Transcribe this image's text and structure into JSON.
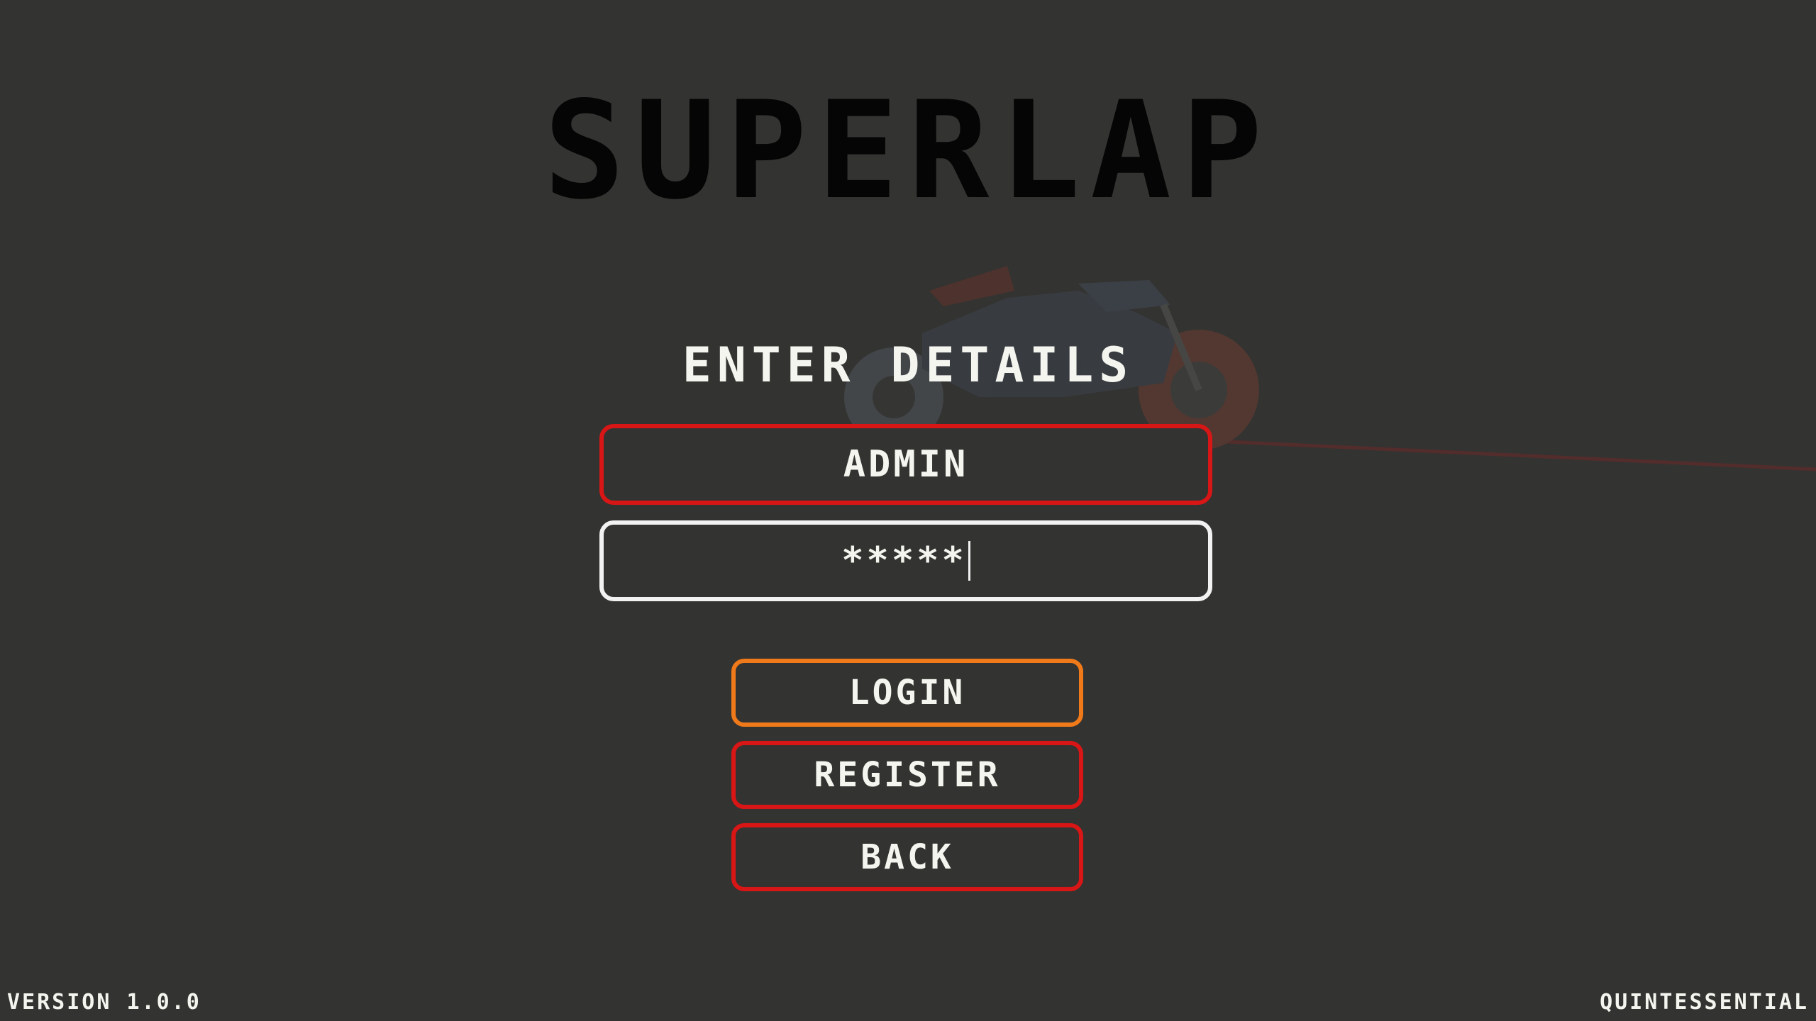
{
  "title": "SUPERLAP",
  "heading": "ENTER DETAILS",
  "username": {
    "value": "ADMIN"
  },
  "password": {
    "value": "*****"
  },
  "buttons": {
    "login": "LOGIN",
    "register": "REGISTER",
    "back": "BACK"
  },
  "footer": {
    "version": "VERSION 1.0.0",
    "studio": "QUINTESSENTIAL"
  },
  "colors": {
    "background": "#333331",
    "selected_border": "#f07a1a",
    "accent_border": "#d81616",
    "active_field_border": "#f2f2f2",
    "text": "#f5f5f0"
  }
}
